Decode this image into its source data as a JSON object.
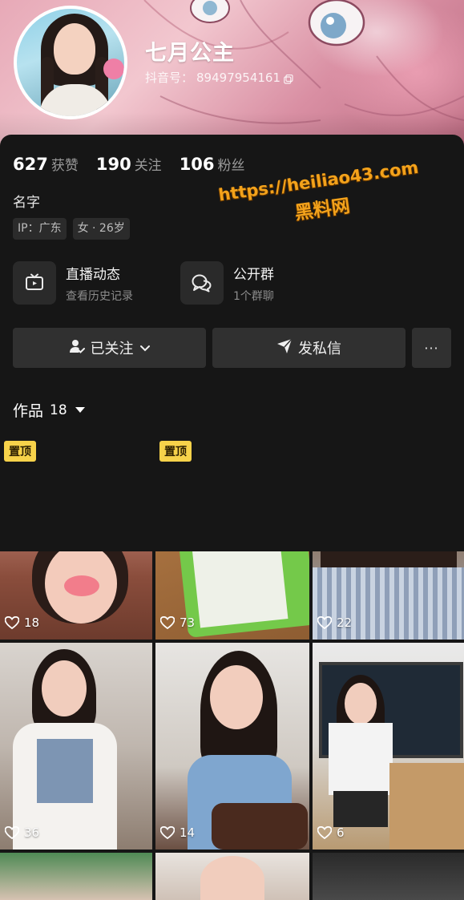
{
  "profile": {
    "username": "七月公主",
    "douyin_id_label": "抖音号：",
    "douyin_id": "89497954161",
    "stats": [
      {
        "value": "627",
        "label": "获赞"
      },
      {
        "value": "190",
        "label": "关注"
      },
      {
        "value": "106",
        "label": "粉丝"
      }
    ],
    "bio": "名字",
    "tags": [
      "IP：广东",
      "女 · 26岁"
    ]
  },
  "watermark": {
    "url": "https://heiliao43.com",
    "site": "黑料网"
  },
  "features": [
    {
      "title": "直播动态",
      "subtitle": "查看历史记录",
      "icon": "tv-icon"
    },
    {
      "title": "公开群",
      "subtitle": "1个群聊",
      "icon": "chat-bubbles-icon"
    }
  ],
  "actions": {
    "follow_label": "已关注",
    "message_label": "发私信",
    "more_label": "···"
  },
  "works": {
    "label": "作品",
    "count": "18"
  },
  "videos": [
    {
      "likes": "18",
      "pinned_label": "置顶"
    },
    {
      "likes": "73",
      "pinned_label": "置顶"
    },
    {
      "likes": "22"
    },
    {
      "likes": "36"
    },
    {
      "likes": "14"
    },
    {
      "likes": "6"
    },
    {},
    {},
    {}
  ],
  "colors": {
    "background": "#161616",
    "button": "#303030",
    "pin_badge": "#f7d24a",
    "watermark": "#f3a21b"
  }
}
